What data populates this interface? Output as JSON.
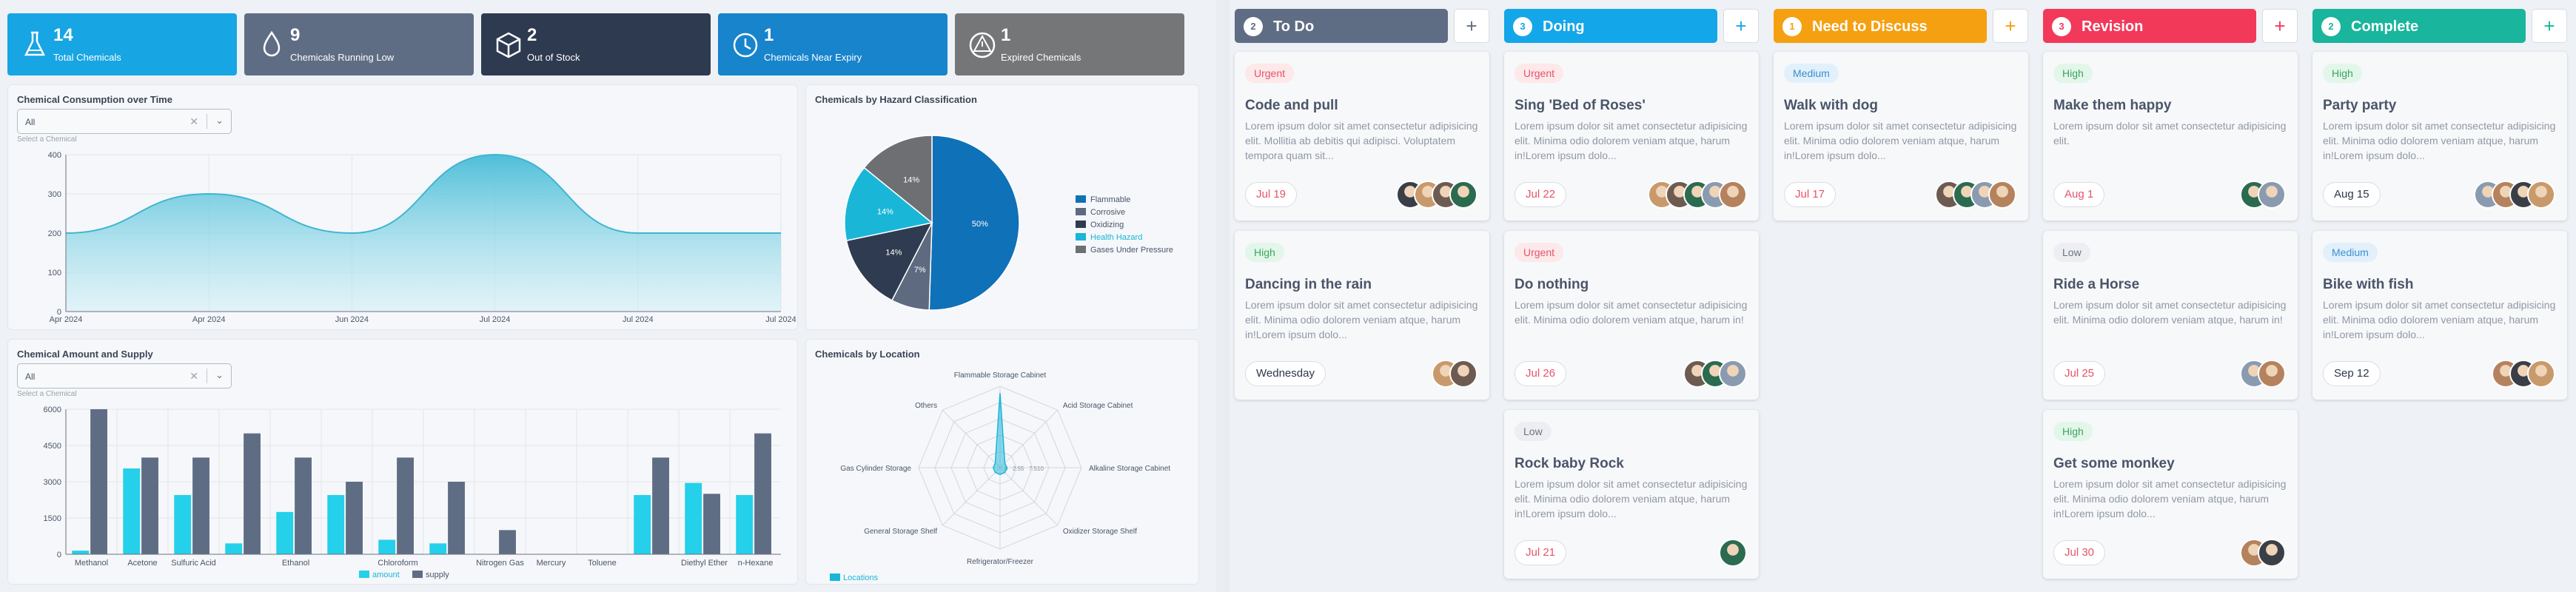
{
  "stats": [
    {
      "value": "14",
      "label": "Total Chemicals",
      "icon": "flask-icon",
      "color": "#17a5e3"
    },
    {
      "value": "9",
      "label": "Chemicals Running Low",
      "icon": "drop-icon",
      "color": "#5f6d84"
    },
    {
      "value": "2",
      "label": "Out of Stock",
      "icon": "box-icon",
      "color": "#2e3a50"
    },
    {
      "value": "1",
      "label": "Chemicals Near Expiry",
      "icon": "clock-icon",
      "color": "#1784cc"
    },
    {
      "value": "1",
      "label": "Expired Chemicals",
      "icon": "hazard-icon",
      "color": "#757678"
    }
  ],
  "consumption": {
    "title": "Chemical Consumption over Time",
    "select_value": "All",
    "select_hint": "Select a Chemical"
  },
  "amount": {
    "title": "Chemical Amount and Supply",
    "select_value": "All",
    "select_hint": "Select a Chemical"
  },
  "hazard": {
    "title": "Chemicals by Hazard Classification"
  },
  "location": {
    "title": "Chemicals by Location"
  },
  "chart_data": [
    {
      "type": "area",
      "title": "Chemical Consumption over Time",
      "x": [
        "Apr 2024",
        "Apr 2024",
        "Jun 2024",
        "Jul 2024",
        "Jul 2024",
        "Jul 2024"
      ],
      "points": [
        {
          "t": 0,
          "y": 200
        },
        {
          "t": 1,
          "y": 300
        },
        {
          "t": 2,
          "y": 200
        },
        {
          "t": 3,
          "y": 400
        },
        {
          "t": 4,
          "y": 200
        },
        {
          "t": 5,
          "y": 200
        }
      ],
      "yticks": [
        0,
        100,
        200,
        300,
        400
      ],
      "ylim": [
        0,
        400
      ],
      "color": "#5fc8dd"
    },
    {
      "type": "pie",
      "title": "Chemicals by Hazard Classification",
      "categories": [
        "Flammable",
        "Corrosive",
        "Oxidizing",
        "Health Hazard",
        "Gases Under Pressure"
      ],
      "values": [
        50,
        7,
        14,
        14,
        14
      ],
      "slice_labels": [
        "50%",
        "7%",
        "14%",
        "14%",
        "14%"
      ],
      "colors": [
        "#0f71b8",
        "#5d6a80",
        "#2f3b50",
        "#19b6d8",
        "#6d6f72"
      ],
      "legend": "right"
    },
    {
      "type": "bar",
      "title": "Chemical Amount and Supply",
      "categories": [
        "Methanol",
        "Acetone",
        "Sulfuric Acid",
        "",
        "Ethanol",
        "",
        "Chloroform",
        "",
        "Nitrogen Gas",
        "Mercury",
        "Toluene",
        "",
        "Diethyl Ether",
        "n-Hexane"
      ],
      "series": [
        {
          "name": "amount",
          "color": "#25d0ea",
          "values": [
            150,
            3550,
            2450,
            450,
            1750,
            2450,
            600,
            450,
            0,
            0,
            0,
            2450,
            2950,
            2450
          ]
        },
        {
          "name": "supply",
          "color": "#5f6d84",
          "values": [
            6000,
            4000,
            4000,
            5000,
            4000,
            3000,
            4000,
            3000,
            1000,
            0,
            0,
            4000,
            2500,
            5000
          ]
        }
      ],
      "yticks": [
        0,
        1500,
        3000,
        4500,
        6000
      ],
      "ylim": [
        0,
        6000
      ],
      "legend": "bottom"
    },
    {
      "type": "radar",
      "title": "Chemicals by Location",
      "axes": [
        "Flammable Storage Cabinet",
        "Acid Storage Cabinet",
        "Alkaline Storage Cabinet",
        "Oxidizer Storage Shelf",
        "Refrigerator/Freezer",
        "General Storage Shelf",
        "Gas Cylinder Storage",
        "Others"
      ],
      "series": [
        {
          "name": "Locations",
          "values": [
            11,
            1,
            1,
            1,
            1,
            1,
            1,
            1
          ],
          "color": "#19b6d8"
        }
      ],
      "ticks": [
        "0",
        "2.5",
        "5",
        "7.5",
        "10"
      ],
      "rmax": 12,
      "legend": "bottom"
    }
  ],
  "kanban": [
    {
      "name": "To Do",
      "count": "2",
      "color": "#5f6d84",
      "add_color": "#5f6d84",
      "cards": [
        {
          "badge": "Urgent",
          "title": "Code and pull",
          "desc": "Lorem ipsum dolor sit amet consectetur adipisicing elit. Mollitia ab debitis qui adipisci. Voluptatem tempora quam sit...",
          "date": "Jul 19",
          "avatars": 4
        },
        {
          "badge": "High",
          "title": "Dancing in the rain",
          "desc": "Lorem ipsum dolor sit amet consectetur adipisicing elit. Minima odio dolorem veniam atque, harum in!Lorem ipsum dolo...",
          "date": "Wednesday",
          "avatars": 2
        }
      ]
    },
    {
      "name": "Doing",
      "count": "3",
      "color": "#13a6e8",
      "add_color": "#13a6e8",
      "cards": [
        {
          "badge": "Urgent",
          "title": "Sing 'Bed of Roses'",
          "desc": "Lorem ipsum dolor sit amet consectetur adipisicing elit. Minima odio dolorem veniam atque, harum in!Lorem ipsum dolo...",
          "date": "Jul 22",
          "avatars": 5
        },
        {
          "badge": "Urgent",
          "title": "Do nothing",
          "desc": "Lorem ipsum dolor sit amet consectetur adipisicing elit. Minima odio dolorem veniam atque, harum in!",
          "date": "Jul 26",
          "avatars": 3
        },
        {
          "badge": "Low",
          "title": "Rock baby Rock",
          "desc": "Lorem ipsum dolor sit amet consectetur adipisicing elit. Minima odio dolorem veniam atque, harum in!Lorem ipsum dolo...",
          "date": "Jul 21",
          "avatars": 1
        }
      ]
    },
    {
      "name": "Need to Discuss",
      "count": "1",
      "color": "#f5a011",
      "add_color": "#f5a011",
      "cards": [
        {
          "badge": "Medium",
          "title": "Walk with dog",
          "desc": "Lorem ipsum dolor sit amet consectetur adipisicing elit. Minima odio dolorem veniam atque, harum in!Lorem ipsum dolo...",
          "date": "Jul 17",
          "avatars": 4
        }
      ]
    },
    {
      "name": "Revision",
      "count": "3",
      "color": "#f2395a",
      "add_color": "#f2395a",
      "cards": [
        {
          "badge": "High",
          "title": "Make them happy",
          "desc": "Lorem ipsum dolor sit amet consectetur adipisicing elit.",
          "date": "Aug 1",
          "avatars": 2
        },
        {
          "badge": "Low",
          "title": "Ride a Horse",
          "desc": "Lorem ipsum dolor sit amet consectetur adipisicing elit. Minima odio dolorem veniam atque, harum in!",
          "date": "Jul 25",
          "avatars": 2
        },
        {
          "badge": "High",
          "title": "Get some monkey",
          "desc": "Lorem ipsum dolor sit amet consectetur adipisicing elit. Minima odio dolorem veniam atque, harum in!Lorem ipsum dolo...",
          "date": "Jul 30",
          "avatars": 2
        }
      ]
    },
    {
      "name": "Complete",
      "count": "2",
      "color": "#19b59d",
      "add_color": "#19b59d",
      "cards": [
        {
          "badge": "High",
          "title": "Party party",
          "desc": "Lorem ipsum dolor sit amet consectetur adipisicing elit. Minima odio dolorem veniam atque, harum in!Lorem ipsum dolo...",
          "date": "Aug 15",
          "avatars": 4
        },
        {
          "badge": "Medium",
          "title": "Bike with fish",
          "desc": "Lorem ipsum dolor sit amet consectetur adipisicing elit. Minima odio dolorem veniam atque, harum in!Lorem ipsum dolo...",
          "date": "Sep 12",
          "avatars": 3
        }
      ]
    }
  ],
  "badge_colors": {
    "Urgent": [
      "#fde8ea",
      "#e5536b"
    ],
    "High": [
      "#e3f6ea",
      "#3aa55e"
    ],
    "Medium": [
      "#e2f0fb",
      "#3a8fd0"
    ],
    "Low": [
      "#eceef1",
      "#6b7280"
    ]
  },
  "date_colors": {
    "red": "#e5536b",
    "dark": "#2d3748"
  }
}
